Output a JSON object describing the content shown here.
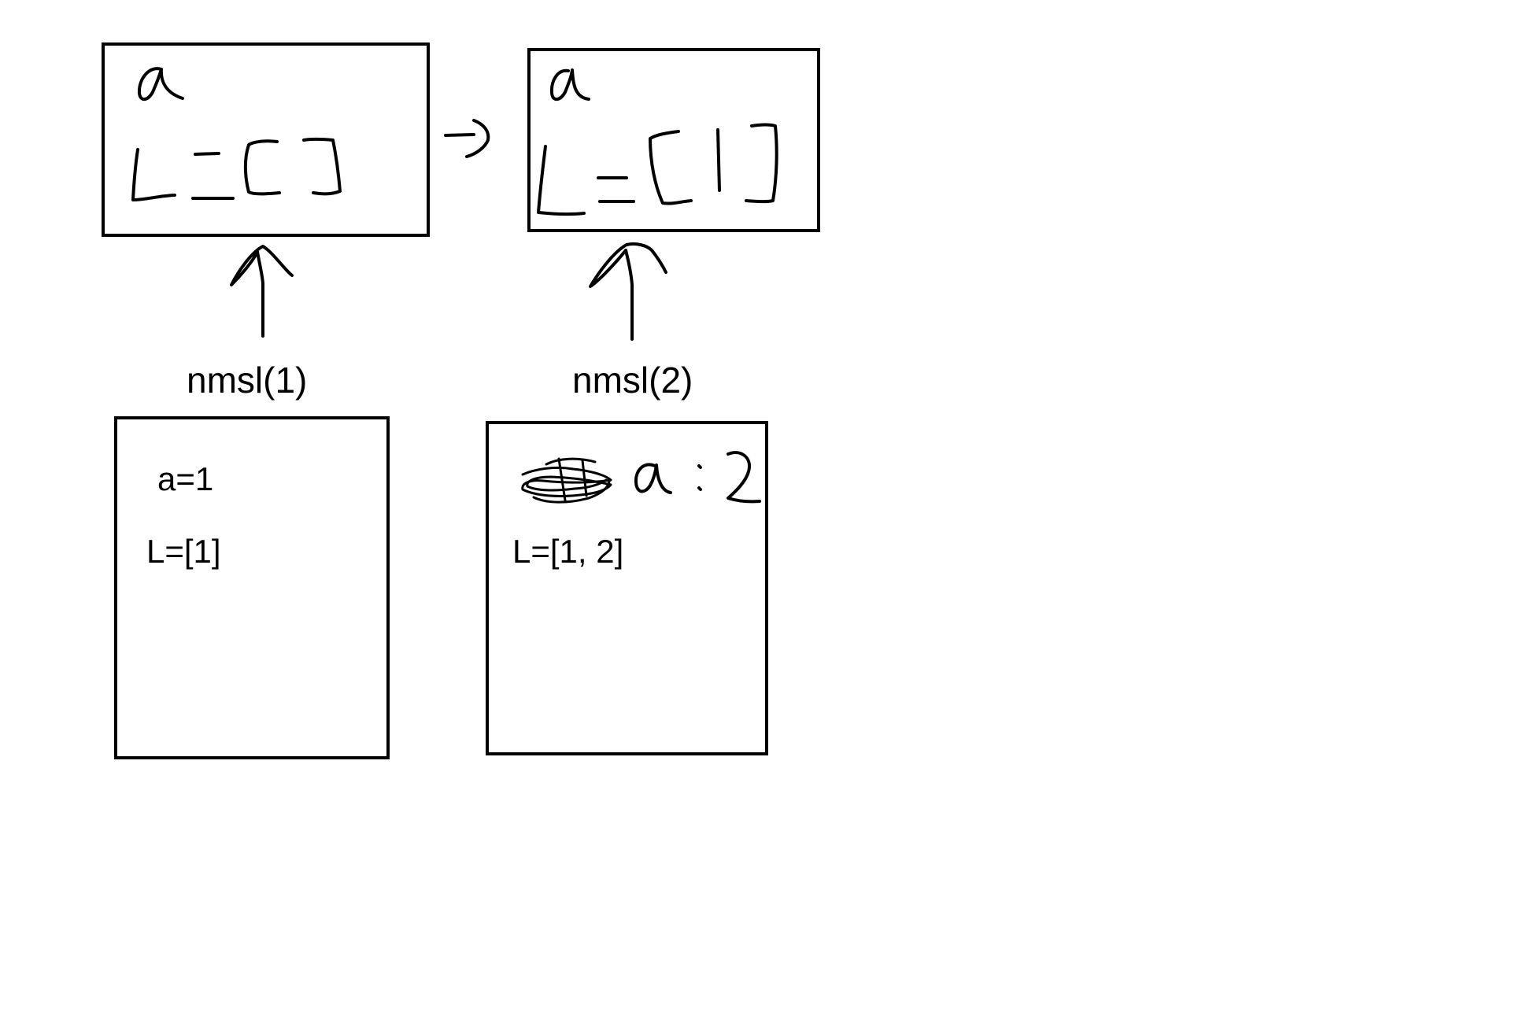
{
  "calls": [
    {
      "label": "nmsl(1)"
    },
    {
      "label": "nmsl(2)"
    }
  ],
  "frames": [
    {
      "a_value": "a=1",
      "L_value": "L=[1]"
    },
    {
      "L_value": "L=[1, 2]"
    }
  ],
  "colors": {
    "ink": "#000000",
    "background": "#ffffff"
  }
}
